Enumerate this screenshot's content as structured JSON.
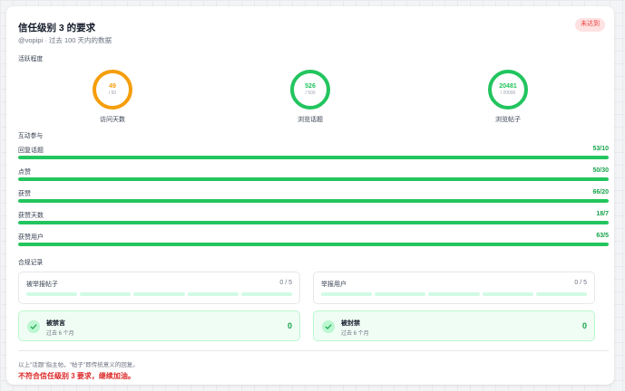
{
  "header": {
    "title": "信任级别 3 的要求",
    "badge": "未达到",
    "subtitle": "@vopipi · 过去 100 天内的数据"
  },
  "activity": {
    "section_label": "活跃程度",
    "gauges": [
      {
        "value": "49",
        "max": "/ 50",
        "label": "访问天数",
        "ratio": 0.98,
        "color": "#f59e0b"
      },
      {
        "value": "526",
        "max": "/ 500",
        "label": "浏览话题",
        "ratio": 1.0,
        "color": "#22c55e"
      },
      {
        "value": "20481",
        "max": "/ 20000",
        "label": "浏览帖子",
        "ratio": 1.0,
        "color": "#22c55e"
      }
    ]
  },
  "engagement": {
    "section_label": "互动参与",
    "metrics": [
      {
        "name": "回复话题",
        "value": "53/10",
        "ratio": 1.0
      },
      {
        "name": "点赞",
        "value": "50/30",
        "ratio": 1.0
      },
      {
        "name": "获赞",
        "value": "66/20",
        "ratio": 1.0
      },
      {
        "name": "获赞天数",
        "value": "18/7",
        "ratio": 1.0
      },
      {
        "name": "获赞用户",
        "value": "63/5",
        "ratio": 1.0
      }
    ]
  },
  "compliance": {
    "section_label": "合规记录",
    "reports": [
      {
        "name": "被举报帖子",
        "count": "0 / 5"
      },
      {
        "name": "举报用户",
        "count": "0 / 5"
      }
    ],
    "statuses": [
      {
        "title": "被禁言",
        "sub": "过去 6 个月",
        "count": "0"
      },
      {
        "title": "被封禁",
        "sub": "过去 6 个月",
        "count": "0"
      }
    ]
  },
  "footer": {
    "note": "以上\"话题\"指主帖，\"帖子\"即传统意义的回复。",
    "result": "不符合信任级别 3 要求，继续加油。"
  },
  "colors": {
    "accent_green": "#22c55e",
    "warning_orange": "#f59e0b",
    "danger_red": "#dc2626"
  }
}
